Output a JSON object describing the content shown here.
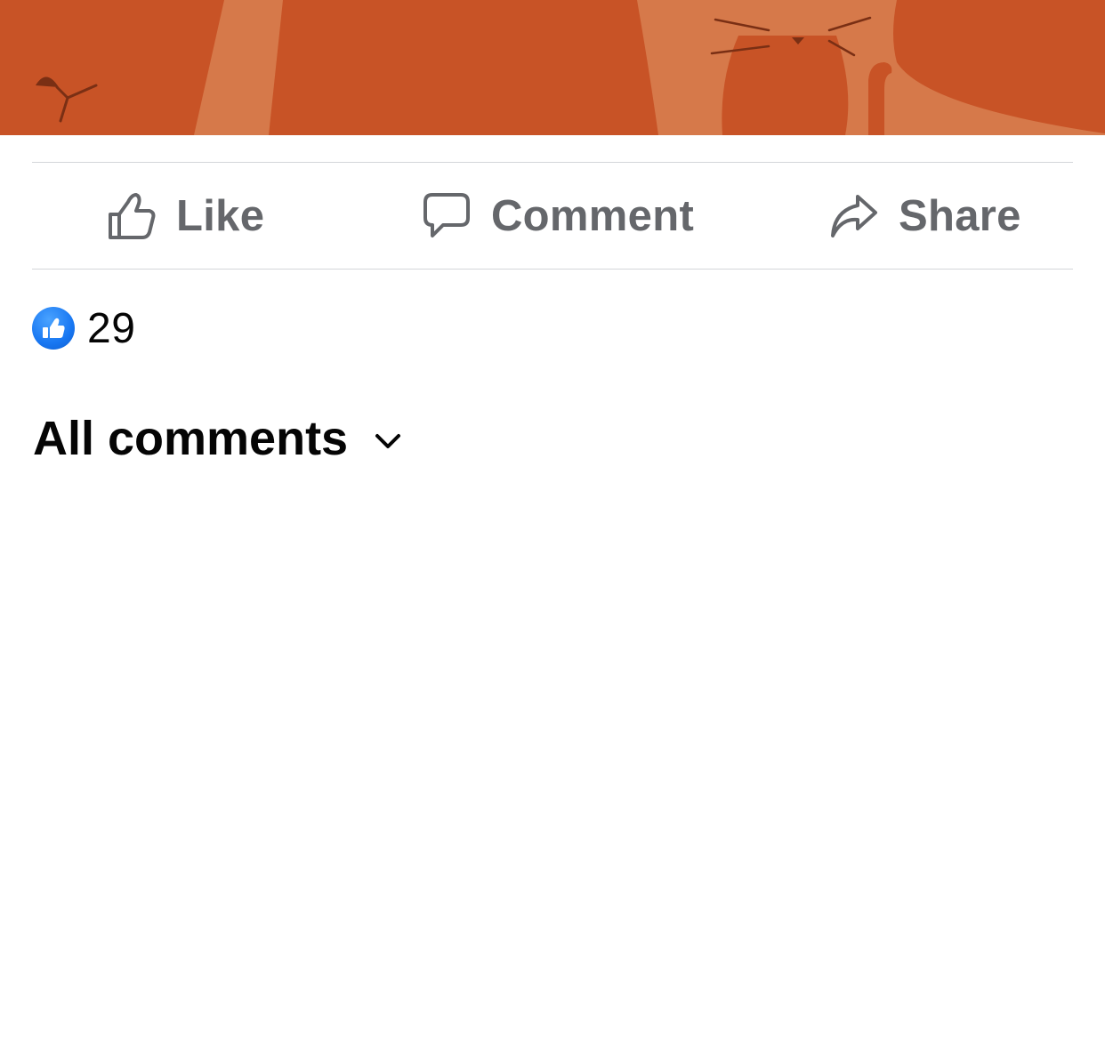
{
  "post": {
    "image": {
      "description_icon": "cat-illustration",
      "background_color": "#c85326",
      "accent_color": "#d6794a"
    }
  },
  "actions": {
    "like": {
      "label": "Like",
      "icon": "thumbs-up-icon"
    },
    "comment": {
      "label": "Comment",
      "icon": "comment-bubble-icon"
    },
    "share": {
      "label": "Share",
      "icon": "share-arrow-icon"
    },
    "color": "#65676b"
  },
  "reactions": {
    "icon": "like-reaction-icon",
    "count": "29",
    "badge_color": "#1877f2"
  },
  "comments": {
    "filter_label": "All comments",
    "filter_icon": "chevron-down-icon"
  }
}
